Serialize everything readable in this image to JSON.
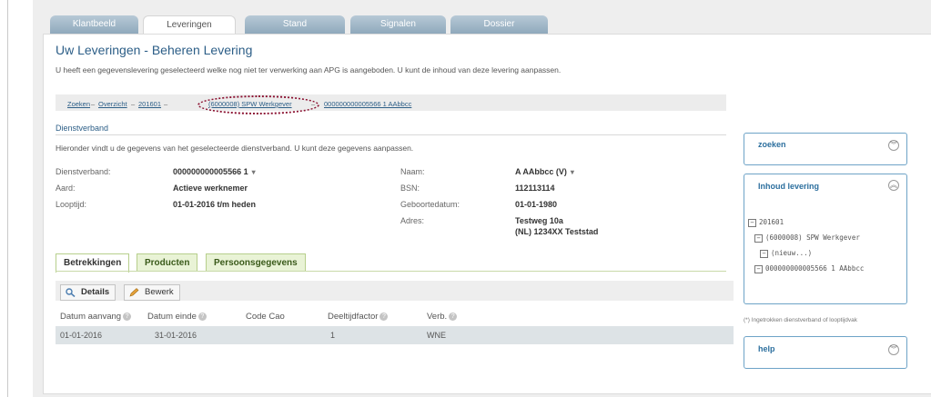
{
  "tabs": [
    "Klantbeeld",
    "Leveringen",
    "Stand",
    "Signalen",
    "Dossier"
  ],
  "page": {
    "title": "Uw Leveringen - Beheren Levering",
    "intro": "U heeft een gegevenslevering geselecteerd welke nog niet ter verwerking aan APG is aangeboden. U kunt de inhoud van deze levering aanpassen."
  },
  "breadcrumb": [
    "Zoeken",
    "Overzicht",
    "201601",
    "(6000008) SPW Werkgever",
    "000000000005566 1 AAbbcc"
  ],
  "section": {
    "title": "Dienstverband",
    "sub": "Hieronder vindt u de gegevens van het geselecteerde dienstverband. U kunt deze gegevens aanpassen."
  },
  "fields": {
    "dienstverband_label": "Dienstverband:",
    "dienstverband_value": "000000000005566 1",
    "aard_label": "Aard:",
    "aard_value": "Actieve werknemer",
    "looptijd_label": "Looptijd:",
    "looptijd_value": "01-01-2016 t/m heden",
    "naam_label": "Naam:",
    "naam_value": "A AAbbcc (V)",
    "bsn_label": "BSN:",
    "bsn_value": "112113114",
    "geboorte_label": "Geboortedatum:",
    "geboorte_value": "01-01-1980",
    "adres_label": "Adres:",
    "adres_line1": "Testweg 10a",
    "adres_line2": "(NL) 1234XX Teststad"
  },
  "detail_tabs": [
    "Betrekkingen",
    "Producten",
    "Persoonsgegevens"
  ],
  "buttons": {
    "details": "Details",
    "bewerk": "Bewerk"
  },
  "table": {
    "headers": [
      "Datum aanvang",
      "Datum einde",
      "Code Cao",
      "Deeltijdfactor",
      "Verb."
    ],
    "rows": [
      [
        "01-01-2016",
        "31-01-2016",
        "",
        "1",
        "WNE"
      ]
    ]
  },
  "sidebar": {
    "zoeken": "zoeken",
    "inhoud": "Inhoud levering",
    "tree": [
      "201601",
      "(6000008) SPW Werkgever",
      "(nieuw...)",
      "000000000005566 1 AAbbcc"
    ],
    "note": "(*) Ingetrokken dienstverband of looptijdvak",
    "help": "help"
  },
  "colors": {
    "accent": "#2c5e87",
    "highlight": "#8a1030",
    "tab_green": "#e9f3d6",
    "row_bg": "#dde3e6"
  }
}
